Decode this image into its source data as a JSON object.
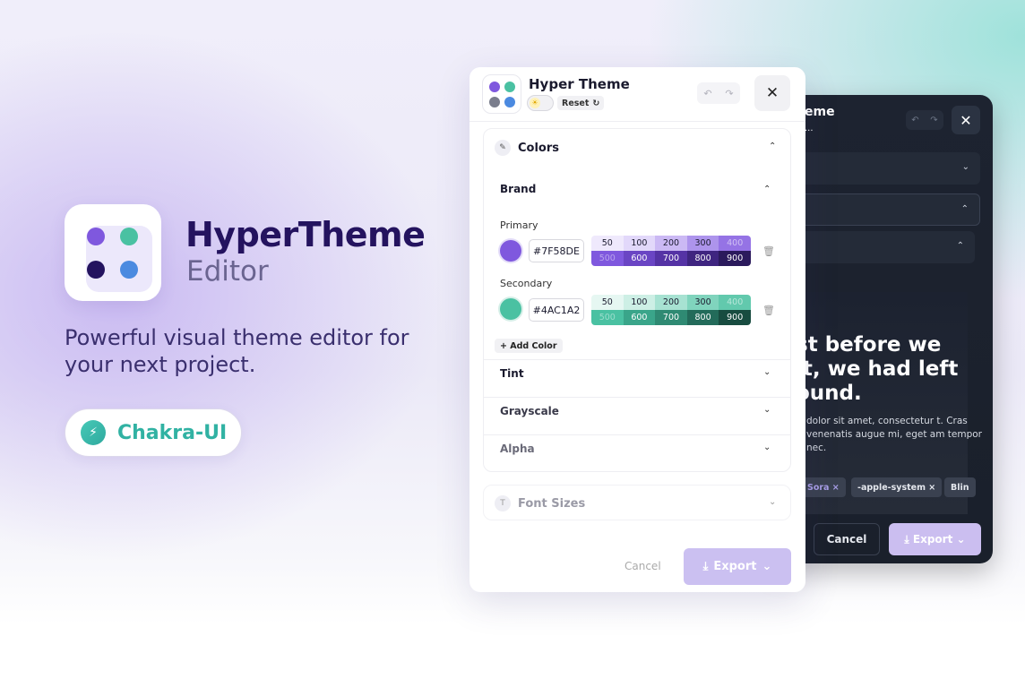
{
  "hero": {
    "name": "HyperTheme",
    "subtitle": "Editor",
    "tagline": "Powerful visual theme editor for your next project.",
    "badge": "Chakra-UI"
  },
  "colors": {
    "primary": "#7F58DE",
    "secondary": "#4AC1A2",
    "dark_navy": "#24135f",
    "blue": "#4b8ae0",
    "grey_dot": "#8a8a9a"
  },
  "editor": {
    "title": "Hyper Theme",
    "reset_label": "Reset",
    "close_glyph": "✕",
    "sections": {
      "colors_label": "Colors",
      "brand_label": "Brand",
      "primary_label": "Primary",
      "primary_hex": "#7F58DE",
      "secondary_label": "Secondary",
      "secondary_hex": "#4AC1A2",
      "add_color_label": "Add Color",
      "tint_label": "Tint",
      "grayscale_label": "Grayscale",
      "alpha_label": "Alpha",
      "font_sizes_label": "Font Sizes"
    },
    "scale_labels": [
      "50",
      "100",
      "200",
      "300",
      "400",
      "500",
      "600",
      "700",
      "800",
      "900"
    ],
    "primary_scale_colors": [
      "#efe9fc",
      "#e2d8fa",
      "#cbb9f4",
      "#ad94ec",
      "#9573e5",
      "#7f58de",
      "#6a45c4",
      "#5533a5",
      "#3f2580",
      "#2b1a5c"
    ],
    "secondary_scale_colors": [
      "#e6f7f2",
      "#cdefe5",
      "#a7e2d2",
      "#80d4bd",
      "#62c9ad",
      "#4ac1a2",
      "#3aa58a",
      "#2f8a73",
      "#236b5a",
      "#184c40"
    ],
    "cancel_label": "Cancel",
    "export_label": "Export"
  },
  "dark_editor": {
    "title_fragment": "eme",
    "subtitle_fragment": "...",
    "heading": "st before we\nit, we had left\nound.",
    "body": "dolor sit amet, consectetur t. Cras venenatis augue mi, eget am tempor nec.",
    "chips": [
      "Sora ×",
      "-apple-system ×",
      "Blin"
    ],
    "cancel_label": "Cancel",
    "export_label": "Export"
  }
}
